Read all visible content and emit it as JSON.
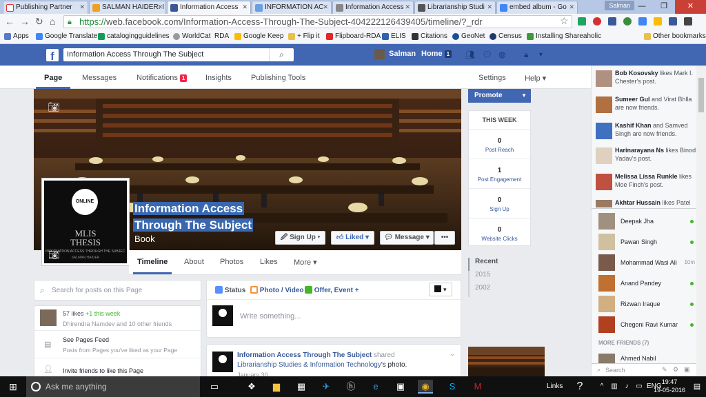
{
  "browser": {
    "tabs": [
      {
        "label": "Publishing Partner",
        "icon": "gmail-icon"
      },
      {
        "label": "SALMAN HAIDER: I",
        "icon": "blogger-icon"
      },
      {
        "label": "Information Access",
        "icon": "facebook-icon",
        "active": true
      },
      {
        "label": "INFORMATION AC",
        "icon": "blogger-icon"
      },
      {
        "label": "Information Access",
        "icon": "blogger-icon"
      },
      {
        "label": "Librarianship Studi",
        "icon": "bookmark-icon"
      },
      {
        "label": "embed album - Go",
        "icon": "google-icon"
      }
    ],
    "profile": "Salman",
    "url_scheme": "https://",
    "url_rest": "web.facebook.com/Information-Access-Through-The-Subject-404222126439405/timeline/?_rdr",
    "bookmarks": [
      "Apps",
      "Google Translate",
      "catalogingguidelines",
      "WorldCat",
      "RDA",
      "Google Keep",
      "+ Flip it",
      "Flipboard-RDA",
      "ELIS",
      "Citations",
      "GeoNet",
      "Census",
      "Installing Shareaholic",
      "Other bookmarks"
    ]
  },
  "fb": {
    "search_value": "Information Access Through The Subject",
    "user": "Salman",
    "home": "Home",
    "home_count": "1"
  },
  "page_tabs": {
    "page": "Page",
    "messages": "Messages",
    "notifications": "Notifications",
    "notif_count": "1",
    "insights": "Insights",
    "publishing": "Publishing Tools",
    "settings": "Settings",
    "help": "Help"
  },
  "profile_pic": {
    "badge": "ONLINE",
    "title1": "MLIS",
    "title2": "THESIS",
    "subtitle": "INFORMATION ACCESS THROUGH THE SUBJECT",
    "author": "SALMAN HAIDER"
  },
  "page": {
    "name1": "Information Access",
    "name2": "Through The Subject",
    "category": "Book"
  },
  "cover_buttons": {
    "signup": "Sign Up",
    "liked": "Liked",
    "message": "Message",
    "more": "•••"
  },
  "timeline_tabs": [
    "Timeline",
    "About",
    "Photos",
    "Likes",
    "More"
  ],
  "left": {
    "search_placeholder": "Search for posts on this Page",
    "likes": "57 likes",
    "likes_week": "+1 this week",
    "friends": "Dhirendra Namdev and 10 other friends",
    "see_feed": "See Pages Feed",
    "see_feed_sub": "Posts from Pages you've liked as your Page",
    "invite": "Invite friends to like this Page"
  },
  "composer": {
    "status": "Status",
    "photo": "Photo / Video",
    "offer": "Offer, Event +",
    "placeholder": "Write something..."
  },
  "post": {
    "author": "Information Access Through The Subject",
    "verb": "shared",
    "source": "Librarianship Studies & Information Technology",
    "suffix": "'s photo.",
    "date": "January 30"
  },
  "promote": "Promote",
  "week": {
    "title": "THIS WEEK",
    "stats": [
      {
        "value": "0",
        "label": "Post Reach"
      },
      {
        "value": "1",
        "label": "Post Engagement"
      },
      {
        "value": "0",
        "label": "Sign Up"
      },
      {
        "value": "0",
        "label": "Website Clicks"
      }
    ]
  },
  "years": [
    "Recent",
    "2015",
    "2002"
  ],
  "ticker": [
    {
      "name": "Bob Kosovsky",
      "text": " likes Mark I. Chester's post."
    },
    {
      "name": "Sumeer Gul",
      "text": " and Virat Bhlla are now friends."
    },
    {
      "name": "Kashif Khan",
      "text": " and Samved Singh are now friends."
    },
    {
      "name": "Harinarayana Ns",
      "text": " likes Binod Yadav's post."
    },
    {
      "name": "Melissa Lissa Runkle",
      "text": " likes Moe Finch's post."
    },
    {
      "name": "Akhtar Hussain",
      "text": " likes Patel"
    }
  ],
  "chat": [
    {
      "name": "Deepak Jha",
      "time": ""
    },
    {
      "name": "Pawan Singh",
      "time": ""
    },
    {
      "name": "Mohammad Wasi Ali",
      "time": "10m"
    },
    {
      "name": "Anand Pandey",
      "time": ""
    },
    {
      "name": "Rizwan Iraque",
      "time": ""
    },
    {
      "name": "Chegoni Ravi Kumar",
      "time": ""
    }
  ],
  "more_friends": "MORE FRIENDS (7)",
  "more_friend_1": "Ahmed Nabil",
  "chat_search": "Search",
  "taskbar": {
    "cortana": "Ask me anything",
    "links": "Links",
    "lang": "ENG",
    "time": "19:47",
    "date": "19-05-2016"
  }
}
